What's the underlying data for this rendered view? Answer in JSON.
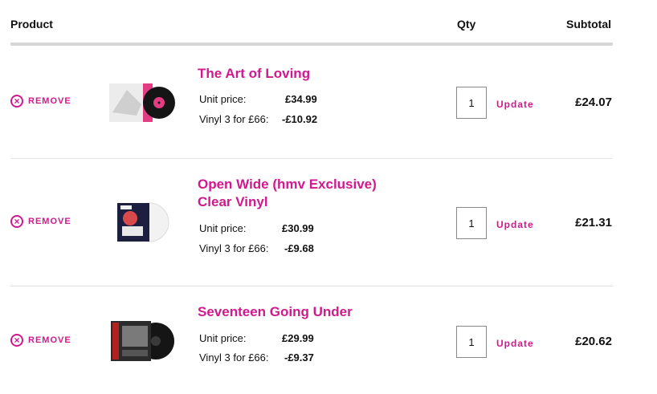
{
  "header": {
    "product": "Product",
    "qty": "Qty",
    "subtotal": "Subtotal"
  },
  "colors": {
    "accent": "#d0198e",
    "rule": "#d6d6d6"
  },
  "items": [
    {
      "remove_label": "REMOVE",
      "title": "The Art of Loving",
      "unit_price_label": "Unit price:",
      "unit_price": "£34.99",
      "discount_label": "Vinyl 3 for £66:",
      "discount": "-£10.92",
      "qty": "1",
      "update_label": "Update",
      "subtotal": "£24.07"
    },
    {
      "remove_label": "REMOVE",
      "title": "Open Wide (hmv Exclusive) Clear Vinyl",
      "unit_price_label": "Unit price:",
      "unit_price": "£30.99",
      "discount_label": "Vinyl 3 for £66:",
      "discount": "-£9.68",
      "qty": "1",
      "update_label": "Update",
      "subtotal": "£21.31"
    },
    {
      "remove_label": "REMOVE",
      "title": "Seventeen Going Under",
      "unit_price_label": "Unit price:",
      "unit_price": "£29.99",
      "discount_label": "Vinyl 3 for £66:",
      "discount": "-£9.37",
      "qty": "1",
      "update_label": "Update",
      "subtotal": "£20.62"
    }
  ]
}
